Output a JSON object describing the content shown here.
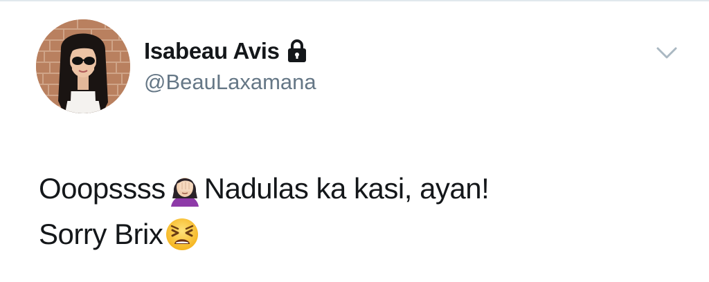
{
  "tweet": {
    "author": {
      "display_name": "Isabeau Avis",
      "username": "@BeauLaxamana",
      "avatar_icon": "profile-photo",
      "protected_icon": "lock-icon"
    },
    "menu_icon": "chevron-down-icon",
    "text": {
      "line1_part1": "Ooopssss",
      "line1_emoji": "person-facepalming-emoji",
      "line1_part2": " Nadulas ka kasi, ayan!",
      "line2_part1": "Sorry Brix",
      "line2_emoji": "tired-face-emoji"
    }
  },
  "colors": {
    "primary_text": "#14171a",
    "secondary_text": "#657786",
    "caret": "#aab8c2",
    "border": "#e1e8ed"
  }
}
